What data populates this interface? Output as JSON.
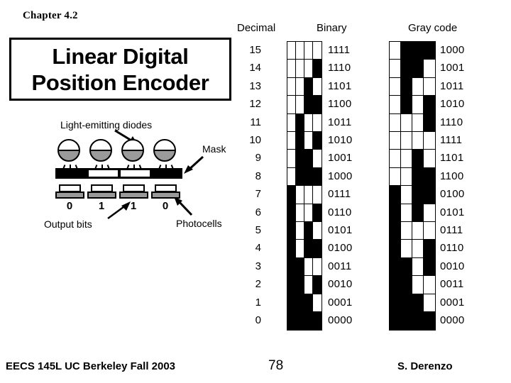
{
  "slide": {
    "chapter": "Chapter 4.2",
    "title_line1": "Linear Digital",
    "title_line2": "Position Encoder"
  },
  "diagram": {
    "labels": {
      "leds": "Light-emitting diodes",
      "mask": "Mask",
      "photocells": "Photocells",
      "output_bits": "Output bits"
    },
    "output_bit_values": [
      "0",
      "1",
      "1",
      "0"
    ],
    "mask_pattern": [
      "opaque",
      "clear",
      "clear",
      "opaque"
    ],
    "led_count": 4,
    "photocell_count": 4
  },
  "table": {
    "headers": {
      "decimal": "Decimal",
      "binary": "Binary",
      "gray": "Gray code"
    },
    "rows": [
      {
        "decimal": "15",
        "binary": "1111",
        "gray": "1000"
      },
      {
        "decimal": "14",
        "binary": "1110",
        "gray": "1001"
      },
      {
        "decimal": "13",
        "binary": "1101",
        "gray": "1011"
      },
      {
        "decimal": "12",
        "binary": "1100",
        "gray": "1010"
      },
      {
        "decimal": "11",
        "binary": "1011",
        "gray": "1110"
      },
      {
        "decimal": "10",
        "binary": "1010",
        "gray": "1111"
      },
      {
        "decimal": "9",
        "binary": "1001",
        "gray": "1101"
      },
      {
        "decimal": "8",
        "binary": "1000",
        "gray": "1100"
      },
      {
        "decimal": "7",
        "binary": "0111",
        "gray": "0100"
      },
      {
        "decimal": "6",
        "binary": "0110",
        "gray": "0101"
      },
      {
        "decimal": "5",
        "binary": "0101",
        "gray": "0111"
      },
      {
        "decimal": "4",
        "binary": "0100",
        "gray": "0110"
      },
      {
        "decimal": "3",
        "binary": "0011",
        "gray": "0010"
      },
      {
        "decimal": "2",
        "binary": "0010",
        "gray": "0011"
      },
      {
        "decimal": "1",
        "binary": "0001",
        "gray": "0001"
      },
      {
        "decimal": "0",
        "binary": "0000",
        "gray": "0000"
      }
    ],
    "legend": {
      "one": "white cell",
      "zero": "black cell"
    }
  },
  "footer": {
    "course": "EECS 145L UC Berkeley Fall 2003",
    "page": "78",
    "author": "S. Derenzo"
  },
  "colors": {
    "ink": "#000000",
    "paper": "#ffffff",
    "shade": "#9a9a9a"
  }
}
